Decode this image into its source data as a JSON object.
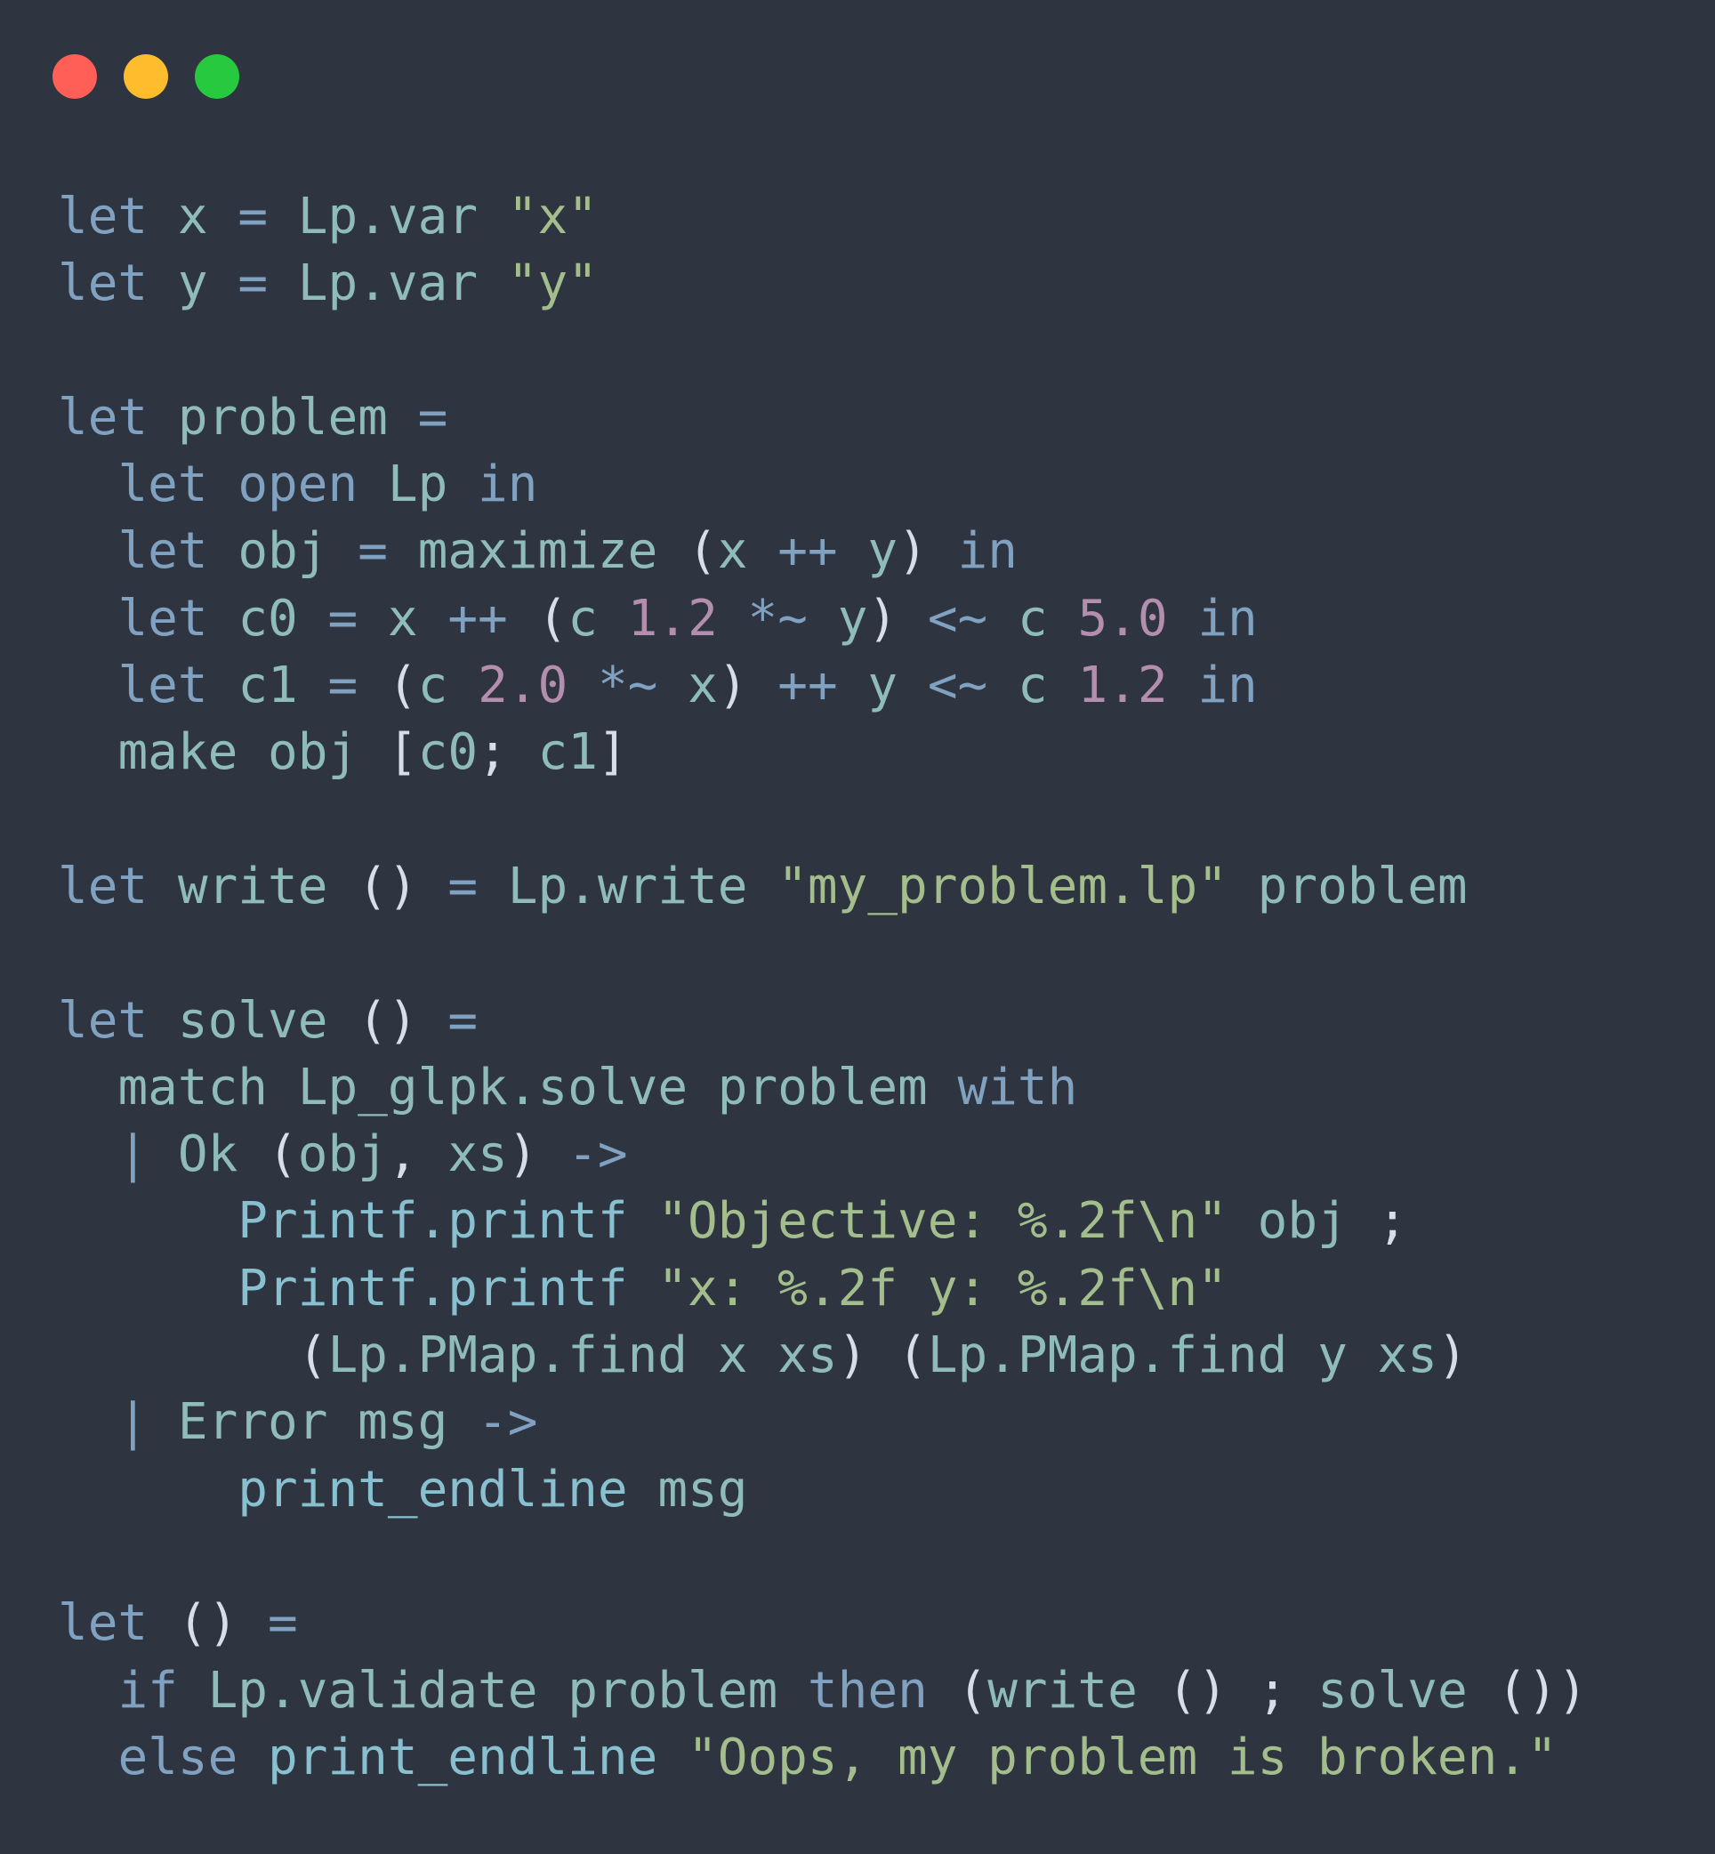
{
  "window": {
    "controls": {
      "close_color": "#ff5f56",
      "minimize_color": "#ffbd2e",
      "zoom_color": "#27c93f"
    }
  },
  "colors": {
    "background": "#2e3440",
    "keyword": "#81a1c1",
    "identifier": "#8fbcbb",
    "string": "#a3be8c",
    "number": "#b48ead",
    "plain": "#d8dee9"
  },
  "code": {
    "lines": [
      [
        [
          "kw",
          "let"
        ],
        [
          "pl",
          " "
        ],
        [
          "id",
          "x"
        ],
        [
          "pl",
          " "
        ],
        [
          "op",
          "="
        ],
        [
          "pl",
          " "
        ],
        [
          "id",
          "Lp.var"
        ],
        [
          "pl",
          " "
        ],
        [
          "str",
          "\"x\""
        ]
      ],
      [
        [
          "kw",
          "let"
        ],
        [
          "pl",
          " "
        ],
        [
          "id",
          "y"
        ],
        [
          "pl",
          " "
        ],
        [
          "op",
          "="
        ],
        [
          "pl",
          " "
        ],
        [
          "id",
          "Lp.var"
        ],
        [
          "pl",
          " "
        ],
        [
          "str",
          "\"y\""
        ]
      ],
      [],
      [
        [
          "kw",
          "let"
        ],
        [
          "pl",
          " "
        ],
        [
          "id",
          "problem"
        ],
        [
          "pl",
          " "
        ],
        [
          "op",
          "="
        ]
      ],
      [
        [
          "pl",
          "  "
        ],
        [
          "kw",
          "let"
        ],
        [
          "pl",
          " "
        ],
        [
          "kw",
          "open"
        ],
        [
          "pl",
          " "
        ],
        [
          "id",
          "Lp"
        ],
        [
          "pl",
          " "
        ],
        [
          "kw",
          "in"
        ]
      ],
      [
        [
          "pl",
          "  "
        ],
        [
          "kw",
          "let"
        ],
        [
          "pl",
          " "
        ],
        [
          "id",
          "obj"
        ],
        [
          "pl",
          " "
        ],
        [
          "op",
          "="
        ],
        [
          "pl",
          " "
        ],
        [
          "id",
          "maximize"
        ],
        [
          "pl",
          " ("
        ],
        [
          "id",
          "x"
        ],
        [
          "pl",
          " "
        ],
        [
          "op",
          "++"
        ],
        [
          "pl",
          " "
        ],
        [
          "id",
          "y"
        ],
        [
          "pl",
          ") "
        ],
        [
          "kw",
          "in"
        ]
      ],
      [
        [
          "pl",
          "  "
        ],
        [
          "kw",
          "let"
        ],
        [
          "pl",
          " "
        ],
        [
          "id",
          "c0"
        ],
        [
          "pl",
          " "
        ],
        [
          "op",
          "="
        ],
        [
          "pl",
          " "
        ],
        [
          "id",
          "x"
        ],
        [
          "pl",
          " "
        ],
        [
          "op",
          "++"
        ],
        [
          "pl",
          " ("
        ],
        [
          "id",
          "c"
        ],
        [
          "pl",
          " "
        ],
        [
          "num",
          "1.2"
        ],
        [
          "pl",
          " "
        ],
        [
          "op",
          "*~"
        ],
        [
          "pl",
          " "
        ],
        [
          "id",
          "y"
        ],
        [
          "pl",
          ") "
        ],
        [
          "op",
          "<~"
        ],
        [
          "pl",
          " "
        ],
        [
          "id",
          "c"
        ],
        [
          "pl",
          " "
        ],
        [
          "num",
          "5.0"
        ],
        [
          "pl",
          " "
        ],
        [
          "kw",
          "in"
        ]
      ],
      [
        [
          "pl",
          "  "
        ],
        [
          "kw",
          "let"
        ],
        [
          "pl",
          " "
        ],
        [
          "id",
          "c1"
        ],
        [
          "pl",
          " "
        ],
        [
          "op",
          "="
        ],
        [
          "pl",
          " ("
        ],
        [
          "id",
          "c"
        ],
        [
          "pl",
          " "
        ],
        [
          "num",
          "2.0"
        ],
        [
          "pl",
          " "
        ],
        [
          "op",
          "*~"
        ],
        [
          "pl",
          " "
        ],
        [
          "id",
          "x"
        ],
        [
          "pl",
          ") "
        ],
        [
          "op",
          "++"
        ],
        [
          "pl",
          " "
        ],
        [
          "id",
          "y"
        ],
        [
          "pl",
          " "
        ],
        [
          "op",
          "<~"
        ],
        [
          "pl",
          " "
        ],
        [
          "id",
          "c"
        ],
        [
          "pl",
          " "
        ],
        [
          "num",
          "1.2"
        ],
        [
          "pl",
          " "
        ],
        [
          "kw",
          "in"
        ]
      ],
      [
        [
          "pl",
          "  "
        ],
        [
          "id",
          "make"
        ],
        [
          "pl",
          " "
        ],
        [
          "id",
          "obj"
        ],
        [
          "pl",
          " ["
        ],
        [
          "id",
          "c0"
        ],
        [
          "pl",
          "; "
        ],
        [
          "id",
          "c1"
        ],
        [
          "pl",
          "]"
        ]
      ],
      [],
      [
        [
          "kw",
          "let"
        ],
        [
          "pl",
          " "
        ],
        [
          "id",
          "write"
        ],
        [
          "pl",
          " () "
        ],
        [
          "op",
          "="
        ],
        [
          "pl",
          " "
        ],
        [
          "id",
          "Lp.write"
        ],
        [
          "pl",
          " "
        ],
        [
          "str",
          "\"my_problem.lp\""
        ],
        [
          "pl",
          " "
        ],
        [
          "id",
          "problem"
        ]
      ],
      [],
      [
        [
          "kw",
          "let"
        ],
        [
          "pl",
          " "
        ],
        [
          "id",
          "solve"
        ],
        [
          "pl",
          " () "
        ],
        [
          "op",
          "="
        ]
      ],
      [
        [
          "pl",
          "  "
        ],
        [
          "id",
          "match"
        ],
        [
          "pl",
          " "
        ],
        [
          "id",
          "Lp_glpk.solve"
        ],
        [
          "pl",
          " "
        ],
        [
          "id",
          "problem"
        ],
        [
          "pl",
          " "
        ],
        [
          "kw",
          "with"
        ]
      ],
      [
        [
          "pl",
          "  "
        ],
        [
          "op",
          "|"
        ],
        [
          "pl",
          " "
        ],
        [
          "id",
          "Ok"
        ],
        [
          "pl",
          " ("
        ],
        [
          "id",
          "obj"
        ],
        [
          "pl",
          ", "
        ],
        [
          "id",
          "xs"
        ],
        [
          "pl",
          ") "
        ],
        [
          "op",
          "->"
        ]
      ],
      [
        [
          "pl",
          "      "
        ],
        [
          "fn",
          "Printf.printf"
        ],
        [
          "pl",
          " "
        ],
        [
          "str",
          "\"Objective: %.2f\\n\""
        ],
        [
          "pl",
          " "
        ],
        [
          "id",
          "obj"
        ],
        [
          "pl",
          " ;"
        ]
      ],
      [
        [
          "pl",
          "      "
        ],
        [
          "fn",
          "Printf.printf"
        ],
        [
          "pl",
          " "
        ],
        [
          "str",
          "\"x: %.2f y: %.2f\\n\""
        ]
      ],
      [
        [
          "pl",
          "        ("
        ],
        [
          "id",
          "Lp.PMap.find"
        ],
        [
          "pl",
          " "
        ],
        [
          "id",
          "x"
        ],
        [
          "pl",
          " "
        ],
        [
          "id",
          "xs"
        ],
        [
          "pl",
          ") ("
        ],
        [
          "id",
          "Lp.PMap.find"
        ],
        [
          "pl",
          " "
        ],
        [
          "id",
          "y"
        ],
        [
          "pl",
          " "
        ],
        [
          "id",
          "xs"
        ],
        [
          "pl",
          ")"
        ]
      ],
      [
        [
          "pl",
          "  "
        ],
        [
          "op",
          "|"
        ],
        [
          "pl",
          " "
        ],
        [
          "id",
          "Error"
        ],
        [
          "pl",
          " "
        ],
        [
          "id",
          "msg"
        ],
        [
          "pl",
          " "
        ],
        [
          "op",
          "->"
        ]
      ],
      [
        [
          "pl",
          "      "
        ],
        [
          "fn",
          "print_endline"
        ],
        [
          "pl",
          " "
        ],
        [
          "id",
          "msg"
        ]
      ],
      [],
      [
        [
          "kw",
          "let"
        ],
        [
          "pl",
          " () "
        ],
        [
          "op",
          "="
        ]
      ],
      [
        [
          "pl",
          "  "
        ],
        [
          "kw",
          "if"
        ],
        [
          "pl",
          " "
        ],
        [
          "id",
          "Lp.validate"
        ],
        [
          "pl",
          " "
        ],
        [
          "id",
          "problem"
        ],
        [
          "pl",
          " "
        ],
        [
          "kw",
          "then"
        ],
        [
          "pl",
          " ("
        ],
        [
          "id",
          "write"
        ],
        [
          "pl",
          " () ; "
        ],
        [
          "id",
          "solve"
        ],
        [
          "pl",
          " ())"
        ]
      ],
      [
        [
          "pl",
          "  "
        ],
        [
          "kw",
          "else"
        ],
        [
          "pl",
          " "
        ],
        [
          "fn",
          "print_endline"
        ],
        [
          "pl",
          " "
        ],
        [
          "str",
          "\"Oops, my problem is broken.\""
        ]
      ]
    ]
  }
}
